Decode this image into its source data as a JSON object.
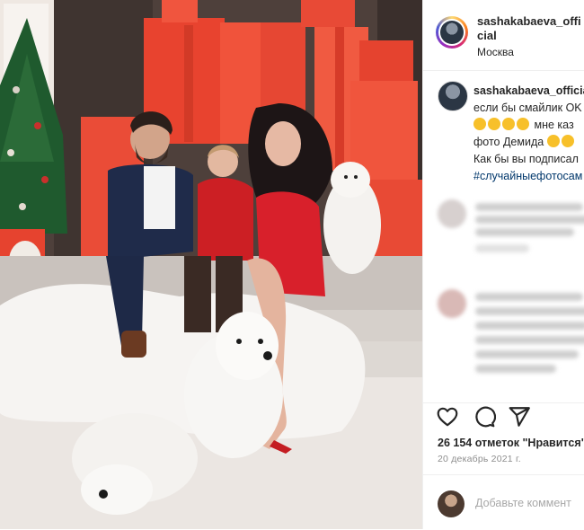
{
  "post": {
    "username": "sashakabaeva_official",
    "username_wrapped": "sashakabaeva_offi cial",
    "location": "Москва"
  },
  "caption": {
    "username": "sashakabaeva_official",
    "line1": "если бы смайлик OK",
    "line2_text": "мне каз",
    "line3": "фото Демида",
    "line4": "Как бы вы подписал",
    "hashtag": "#случайныефотосам"
  },
  "stats": {
    "likes": "26 154 отметок \"Нравится\"",
    "date": "20 декабрь 2021 г."
  },
  "comment_box": {
    "placeholder": "Добавьте коммент"
  },
  "icons": {
    "like": "heart-icon",
    "comment": "comment-icon",
    "share": "share-icon"
  }
}
